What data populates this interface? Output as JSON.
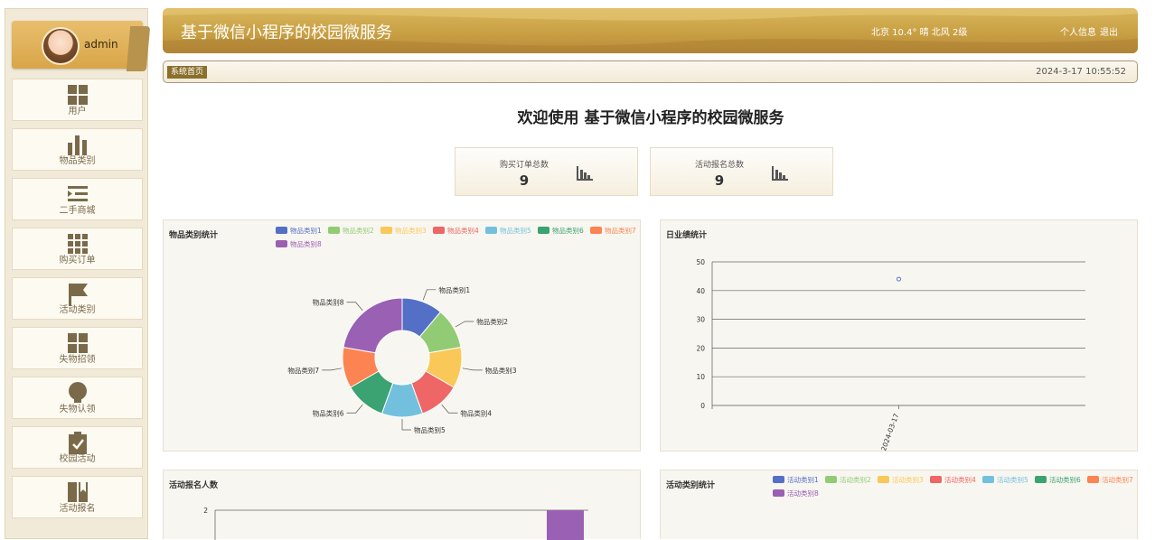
{
  "sidebar": {
    "username": "admin",
    "items": [
      {
        "label": "用户",
        "icon": "grid-icon"
      },
      {
        "label": "物品类别",
        "icon": "bar-chart-icon"
      },
      {
        "label": "二手商城",
        "icon": "list-indent-icon"
      },
      {
        "label": "购买订单",
        "icon": "grid-nine-icon"
      },
      {
        "label": "活动类别",
        "icon": "flag-icon"
      },
      {
        "label": "失物招领",
        "icon": "grid-icon"
      },
      {
        "label": "失物认领",
        "icon": "lightbulb-icon"
      },
      {
        "label": "校园活动",
        "icon": "clipboard-check-icon"
      },
      {
        "label": "活动报名",
        "icon": "book-icon"
      }
    ]
  },
  "header": {
    "title": "基于微信小程序的校园微服务",
    "weather": "北京  10.4°  晴  北风  2级",
    "profile_link": "个人信息",
    "logout_link": "退出"
  },
  "breadcrumb": {
    "current": "系统首页",
    "datetime": "2024-3-17 10:55:52"
  },
  "welcome": "欢迎使用 基于微信小程序的校园微服务",
  "stats": [
    {
      "label": "购买订单总数",
      "value": "9"
    },
    {
      "label": "活动报名总数",
      "value": "9"
    }
  ],
  "colors": {
    "accent": "#c9a044",
    "series": [
      "#5470c6",
      "#91cc75",
      "#fac858",
      "#ee6666",
      "#73c0de",
      "#3ba272",
      "#fc8452",
      "#9a60b4"
    ]
  },
  "panels": {
    "category": "物品类别统计",
    "daily": "日业绩统计",
    "signup": "活动报名人数",
    "activity": "活动类别统计"
  },
  "chart_data": [
    {
      "type": "pie",
      "title": "物品类别统计",
      "categories": [
        "物品类别1",
        "物品类别2",
        "物品类别3",
        "物品类别4",
        "物品类别5",
        "物品类别6",
        "物品类别7",
        "物品类别8"
      ],
      "values": [
        1,
        1,
        1,
        1,
        1,
        1,
        1,
        2
      ],
      "donut": true,
      "legend_position": "top-right"
    },
    {
      "type": "scatter",
      "title": "日业绩统计",
      "x": [
        "2024-03-17"
      ],
      "y": [
        44
      ],
      "ylim": [
        0,
        50
      ],
      "yticks": [
        0,
        10,
        20,
        30,
        40,
        50
      ],
      "grid": true
    },
    {
      "type": "bar",
      "title": "活动报名人数",
      "yticks": [
        2
      ],
      "values": [
        2
      ],
      "partial": true
    },
    {
      "type": "pie",
      "title": "活动类别统计",
      "categories": [
        "活动类别1",
        "活动类别2",
        "活动类别3",
        "活动类别4",
        "活动类别5",
        "活动类别6",
        "活动类别7",
        "活动类别8"
      ],
      "legend_position": "top-right",
      "partial": true
    }
  ]
}
